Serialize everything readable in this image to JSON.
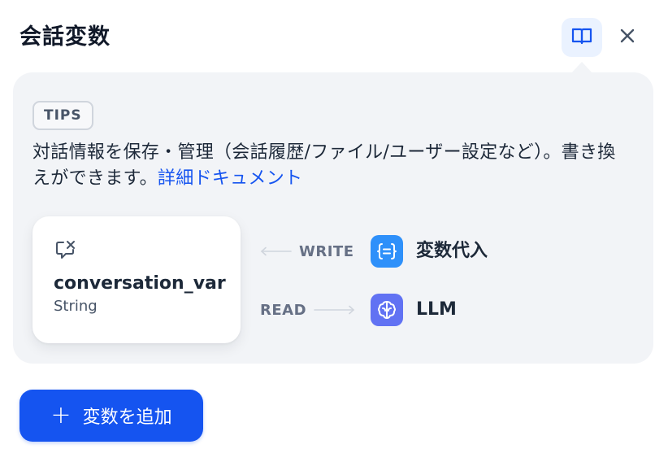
{
  "panel": {
    "title": "会話変数"
  },
  "tips": {
    "badge": "TIPS",
    "text": "対話情報を保存・管理（会話履歴/ファイル/ユーザー設定など）。書き換えができます。",
    "link": "詳細ドキュメント"
  },
  "variable": {
    "name": "conversation_var",
    "type": "String"
  },
  "flow": {
    "write_label": "WRITE",
    "read_label": "READ",
    "write_node": "変数代入",
    "read_node": "LLM"
  },
  "actions": {
    "add_plus": "+",
    "add_label": "変数を追加"
  },
  "colors": {
    "accent": "#1554f0",
    "assigner_node": "#2e90fa",
    "llm_node": "#6172f3",
    "tips_bg": "#f2f4f7"
  },
  "icons": {
    "docs": "book-open-icon",
    "close": "close-icon",
    "variable": "conversation-variable-icon",
    "assigner": "variable-assigner-icon",
    "llm": "llm-brain-icon"
  }
}
